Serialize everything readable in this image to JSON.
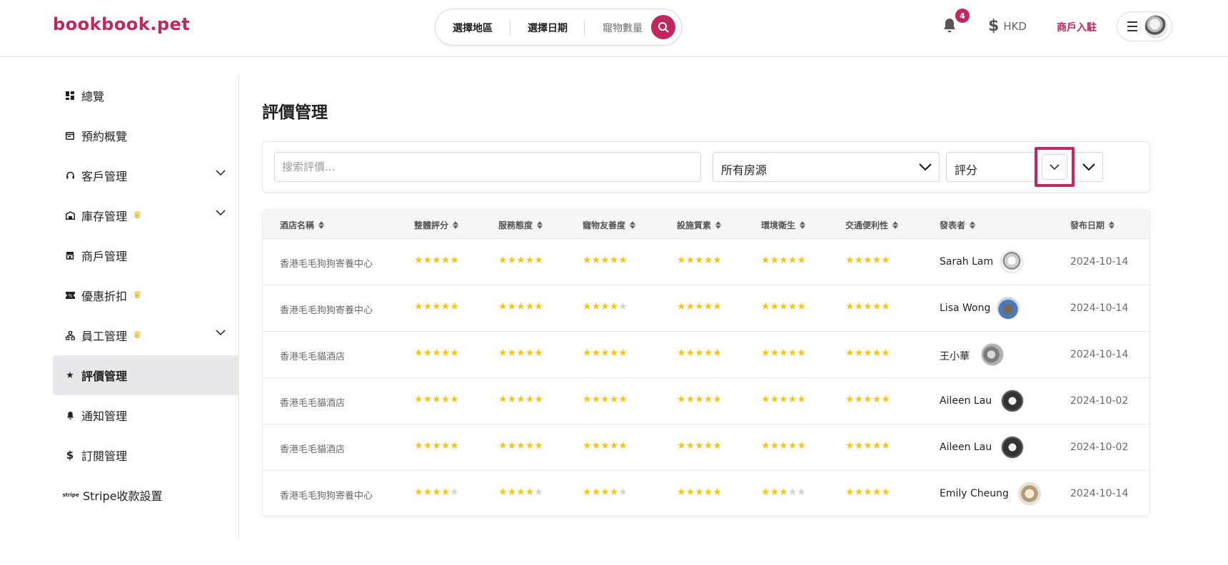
{
  "header": {
    "logo": "bookbook.pet",
    "search": {
      "region": "選擇地區",
      "date": "選擇日期",
      "pets": "寵物數量"
    },
    "notification_count": "4",
    "currency": "HKD",
    "merchant_link": "商戶入駐"
  },
  "sidebar": {
    "items": [
      {
        "label": "總覽",
        "icon": "dashboard-icon"
      },
      {
        "label": "預約概覽",
        "icon": "calendar-icon"
      },
      {
        "label": "客戶管理",
        "icon": "headset-icon",
        "expandable": true
      },
      {
        "label": "庫存管理",
        "icon": "warehouse-icon",
        "premium": true,
        "expandable": true
      },
      {
        "label": "商戶管理",
        "icon": "store-icon"
      },
      {
        "label": "優惠折扣",
        "icon": "ticket-icon",
        "premium": true
      },
      {
        "label": "員工管理",
        "icon": "org-chart-icon",
        "premium": true,
        "expandable": true
      },
      {
        "label": "評價管理",
        "icon": "star-icon",
        "active": true
      },
      {
        "label": "通知管理",
        "icon": "bell-icon"
      },
      {
        "label": "訂閱管理",
        "icon": "dollar-icon"
      },
      {
        "label": "Stripe收款設置",
        "icon": "stripe-icon"
      }
    ]
  },
  "main": {
    "title": "評價管理",
    "filters": {
      "search_placeholder": "搜索評價...",
      "property_select": "所有房源",
      "rating_select": "評分"
    },
    "table": {
      "headers": [
        "酒店名稱",
        "整體評分",
        "服務態度",
        "寵物友善度",
        "設施質素",
        "環境衛生",
        "交通便利性",
        "發表者",
        "發布日期"
      ],
      "rows": [
        {
          "hotel": "香港毛毛狗狗寄養中心",
          "ratings": [
            5,
            5,
            5,
            5,
            5,
            5
          ],
          "poster": "Sarah Lam",
          "date": "2024-10-14"
        },
        {
          "hotel": "香港毛毛狗狗寄養中心",
          "ratings": [
            5,
            5,
            4,
            5,
            5,
            5
          ],
          "poster": "Lisa Wong",
          "date": "2024-10-14"
        },
        {
          "hotel": "香港毛毛貓酒店",
          "ratings": [
            5,
            5,
            5,
            5,
            5,
            5
          ],
          "poster": "王小華",
          "date": "2024-10-14"
        },
        {
          "hotel": "香港毛毛貓酒店",
          "ratings": [
            5,
            5,
            5,
            5,
            5,
            5
          ],
          "poster": "Aileen Lau",
          "date": "2024-10-02"
        },
        {
          "hotel": "香港毛毛貓酒店",
          "ratings": [
            5,
            5,
            5,
            5,
            5,
            5
          ],
          "poster": "Aileen Lau",
          "date": "2024-10-02"
        },
        {
          "hotel": "香港毛毛狗狗寄養中心",
          "ratings": [
            4,
            4,
            4,
            5,
            3,
            5
          ],
          "poster": "Emily Cheung",
          "date": "2024-10-14"
        }
      ]
    }
  },
  "colors": {
    "brand": "#c0275f",
    "star": "#f5c518",
    "star_off": "#d3d3d3",
    "crown": "#e3b22b"
  }
}
